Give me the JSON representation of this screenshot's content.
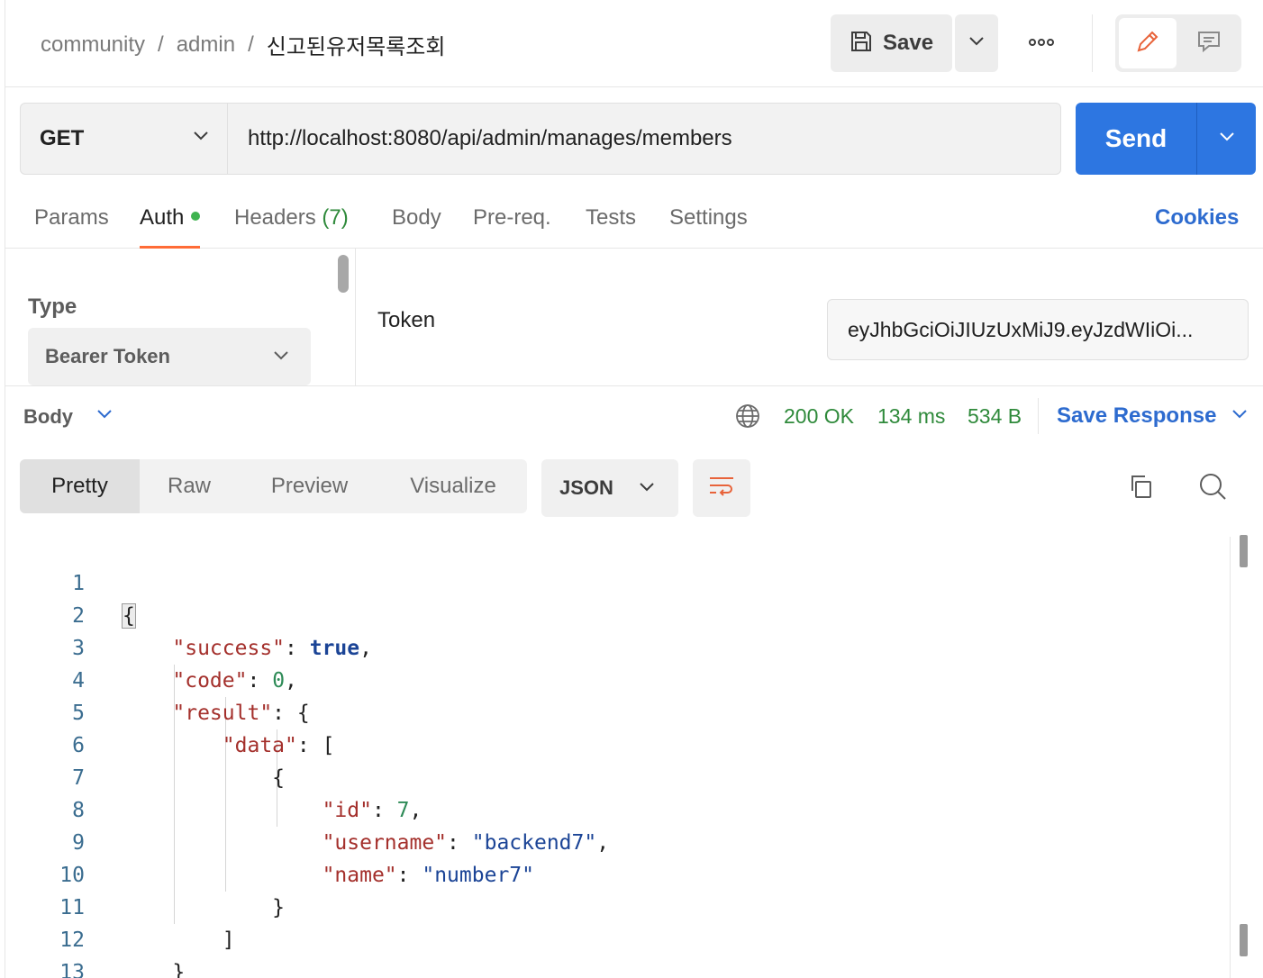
{
  "breadcrumb": {
    "collection": "community",
    "folder": "admin",
    "request": "신고된유저목록조회"
  },
  "toolbar": {
    "save_label": "Save",
    "more_icon": "ellipsis-icon",
    "edit_icon": "pencil-icon",
    "comment_icon": "comment-icon"
  },
  "request": {
    "method": "GET",
    "url": "http://localhost:8080/api/admin/manages/members",
    "send_label": "Send"
  },
  "tabs": {
    "params": "Params",
    "auth": "Auth",
    "headers": "Headers",
    "headers_count": "(7)",
    "body": "Body",
    "prereq": "Pre-req.",
    "tests": "Tests",
    "settings": "Settings",
    "cookies": "Cookies"
  },
  "auth": {
    "type_label": "Type",
    "type_value": "Bearer Token",
    "token_label": "Token",
    "token_value": "eyJhbGciOiJIUzUxMiJ9.eyJzdWIiOi..."
  },
  "response": {
    "body_label": "Body",
    "status": "200 OK",
    "time": "134 ms",
    "size": "534 B",
    "save_response_label": "Save Response"
  },
  "view": {
    "tabs": [
      "Pretty",
      "Raw",
      "Preview",
      "Visualize"
    ],
    "active": "Pretty",
    "format": "JSON"
  },
  "colors": {
    "accent": "#2d76e1",
    "tab_underline": "#ff6c37",
    "status_green": "#2f8a3b",
    "auth_dot": "#3fb34f"
  },
  "code_lines": [
    "{",
    "\"success\": true,",
    "\"code\": 0,",
    "\"result\": {",
    "\"data\": [",
    "{",
    "\"id\": 7,",
    "\"username\": \"backend7\",",
    "\"name\": \"number7\"",
    "}",
    "]",
    "}",
    "}"
  ]
}
